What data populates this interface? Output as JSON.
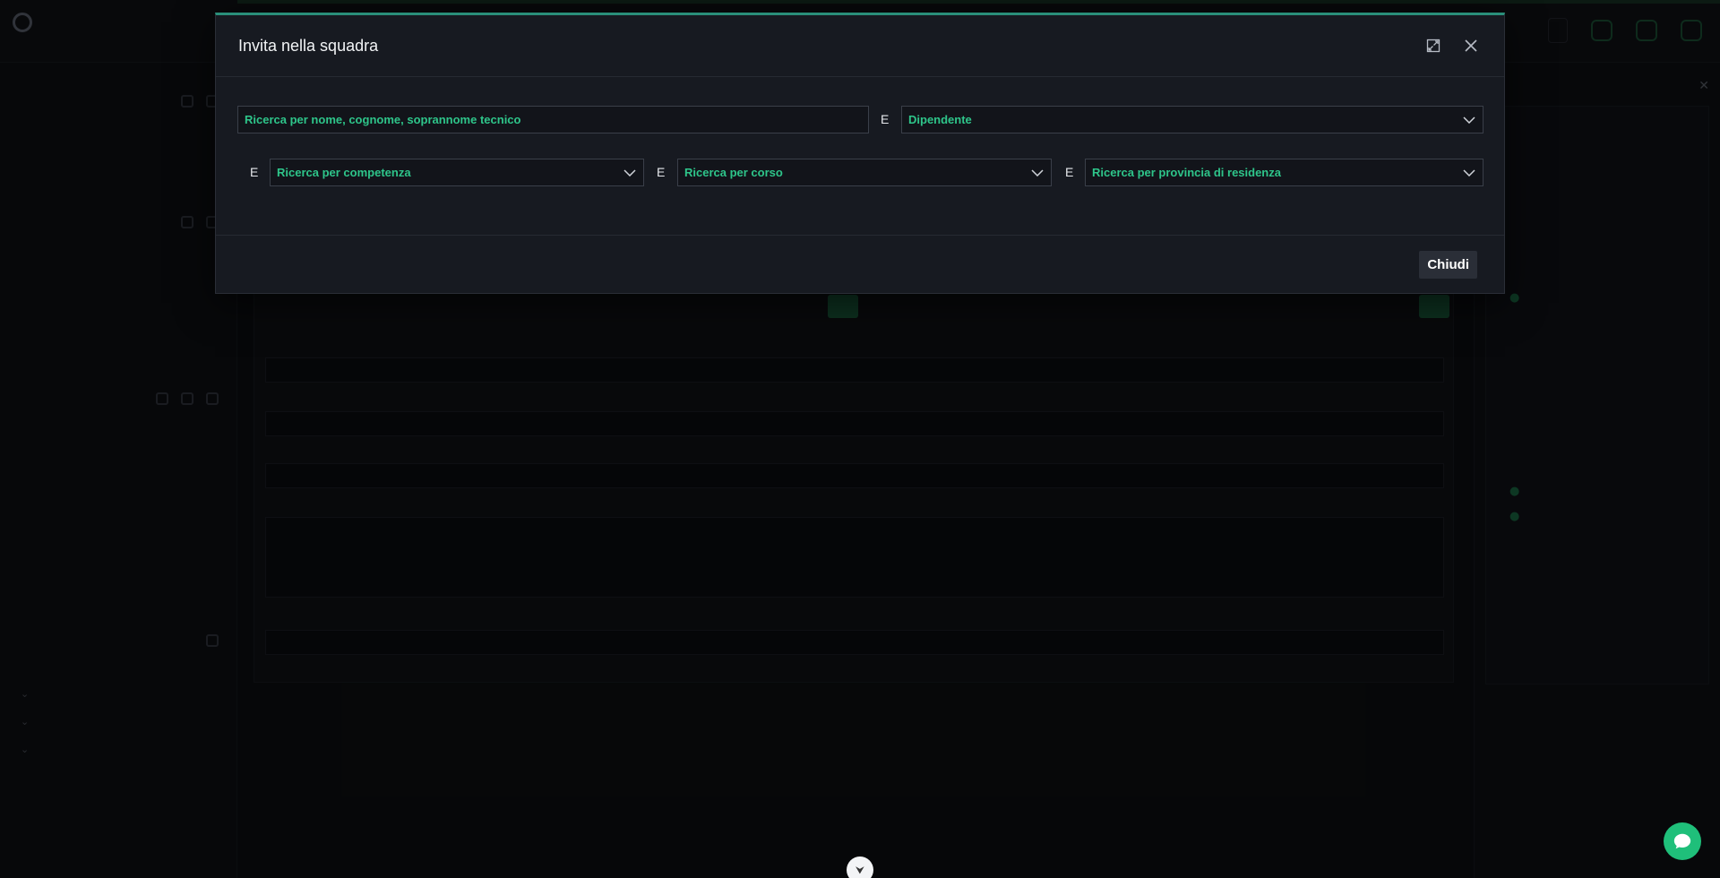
{
  "modal": {
    "title": "Invita nella squadra",
    "search_placeholder": "Ricerca per nome, cognome, soprannome tecnico",
    "conjunction": "E",
    "employee_type_value": "Dipendente",
    "competence_placeholder": "Ricerca per competenza",
    "course_placeholder": "Ricerca per corso",
    "province_placeholder": "Ricerca per provincia di residenza",
    "close_label": "Chiudi"
  },
  "colors": {
    "accent": "#2ec58a",
    "modal_bg": "#171a21",
    "top_border": "#2a8f7a"
  },
  "icons": {
    "expand": "expand-icon",
    "close": "close-icon",
    "dropdown": "chevron-down-icon",
    "chat": "chat-icon"
  }
}
